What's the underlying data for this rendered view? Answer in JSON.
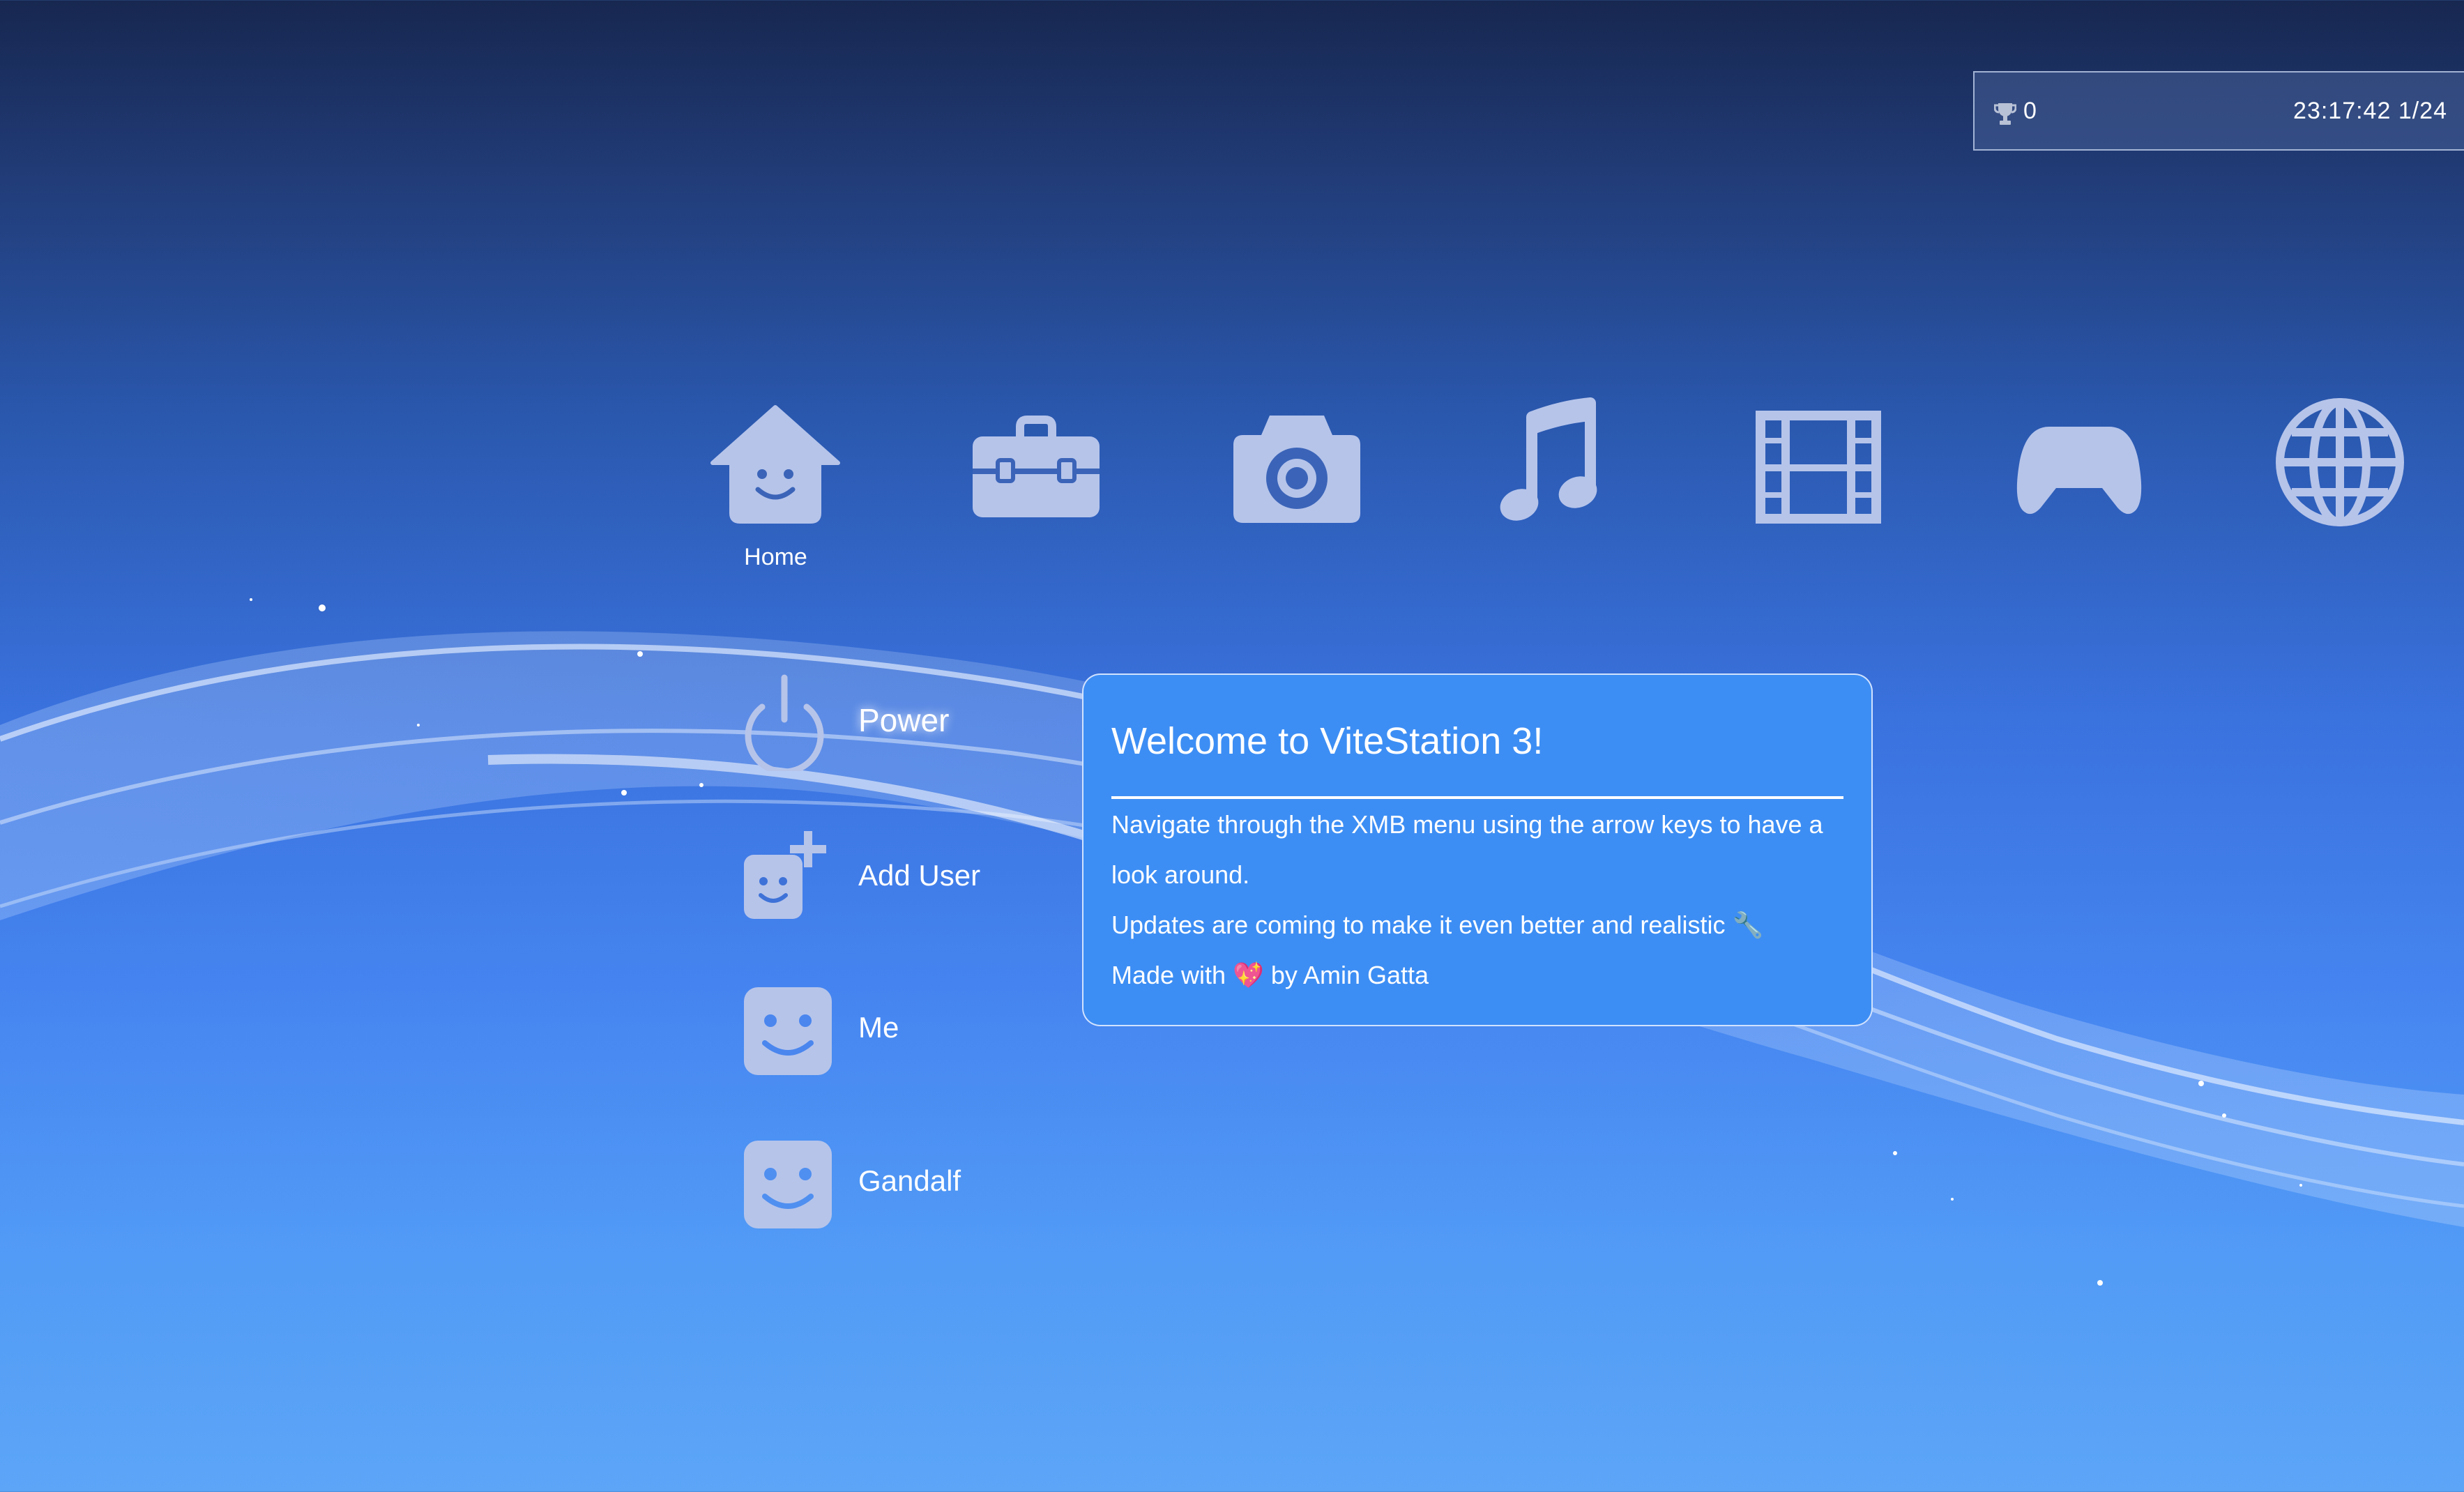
{
  "status_bar": {
    "trophy_icon": "trophy-icon",
    "trophy_count": "0",
    "clock": "23:17:42 1/24"
  },
  "categories": [
    {
      "id": "home",
      "label": "Home",
      "icon": "home-icon",
      "selected": true
    },
    {
      "id": "settings",
      "icon": "toolbox-icon"
    },
    {
      "id": "photo",
      "icon": "camera-icon"
    },
    {
      "id": "music",
      "icon": "music-note-icon"
    },
    {
      "id": "video",
      "icon": "film-icon"
    },
    {
      "id": "game",
      "icon": "gamepad-icon"
    },
    {
      "id": "network",
      "icon": "globe-icon"
    }
  ],
  "submenu": {
    "items": [
      {
        "label": "Power",
        "icon": "power-icon",
        "active": true
      },
      {
        "label": "Add User",
        "icon": "add-user-icon"
      },
      {
        "label": "Me",
        "icon": "user-face-icon"
      },
      {
        "label": "Gandalf",
        "icon": "user-face-icon"
      }
    ]
  },
  "popup": {
    "title": "Welcome to ViteStation 3!",
    "line1": "Navigate through the XMB menu using the arrow keys to have a",
    "line2": "look around.",
    "line3": "Updates are coming to make it even better and realistic 🔧",
    "line4": "Made with 💖 by Amin Gatta"
  },
  "colors": {
    "background_top": "#172750",
    "background_bottom": "#5ca5f7",
    "popup_bg": "#3d8ef4",
    "icon_fill": "#b6c4ea"
  }
}
